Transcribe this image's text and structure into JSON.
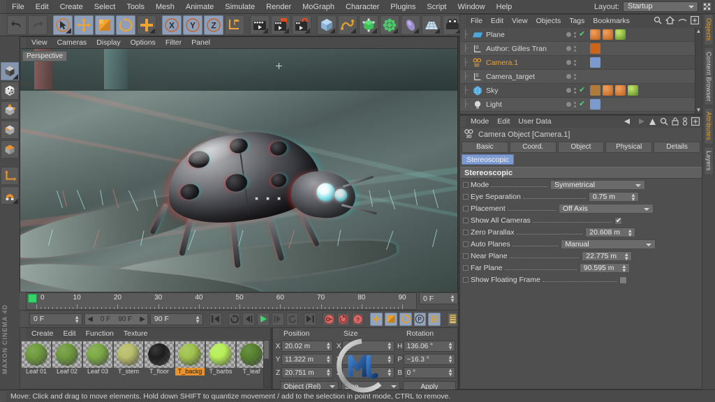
{
  "app": {
    "title": "CINEMA 4D",
    "brand": "MAXON CINEMA 4D"
  },
  "menubar": {
    "items": [
      "File",
      "Edit",
      "Create",
      "Select",
      "Tools",
      "Mesh",
      "Animate",
      "Simulate",
      "Render",
      "MoGraph",
      "Character",
      "Plugins",
      "Script",
      "Window",
      "Help"
    ],
    "layout_label": "Layout:",
    "layout_value": "Startup"
  },
  "toolbar": {
    "undo": "undo-icon",
    "redo": "redo-icon",
    "select": "live-selection-icon",
    "move": "move-icon",
    "scale": "scale-icon",
    "rotate": "rotate-icon",
    "add": "add-icon",
    "axis_x": "X",
    "axis_y": "Y",
    "axis_z": "Z",
    "world": "world-axis-icon",
    "render_view": "render-view-icon",
    "render_region": "render-region-icon",
    "render_settings": "render-settings-icon",
    "primitive": "cube-primitive-icon",
    "spline": "spline-icon",
    "generator": "generator-icon",
    "deformer": "deformer-icon",
    "scene_obj": "environment-icon",
    "scene_ground": "floor-icon",
    "camera": "camera-icon"
  },
  "lefttools": {
    "items": [
      "model-mode-icon",
      "texture-mode-icon",
      "points-mode-icon",
      "edges-mode-icon",
      "polygons-mode-icon",
      "axis-mode-icon",
      "magnet-icon"
    ]
  },
  "viewport": {
    "menu": [
      "View",
      "Cameras",
      "Display",
      "Options",
      "Filter",
      "Panel"
    ],
    "label": "Perspective",
    "scene_description": "Anaglyph stereoscopic render of a ladybug on a leaf"
  },
  "timeline": {
    "ticks": [
      0,
      10,
      20,
      30,
      40,
      50,
      60,
      70,
      80,
      90
    ],
    "current_frame": "0 F",
    "start_frame": "0 F",
    "preview_start": "0 F",
    "preview_end": "90 F",
    "end_frame": "90 F"
  },
  "transport": {
    "go_to_start": "go-to-start-icon",
    "loop": "loop-icon",
    "step_back": "step-back-icon",
    "play": "play-icon",
    "step_forward": "step-forward-icon",
    "replay": "replay-icon",
    "go_to_end": "go-to-end-icon",
    "record": "record-icon",
    "autokey": "autokey-icon",
    "keyframe_select": "keyframe-select-icon",
    "pos": "position-key-icon",
    "scale_k": "scale-key-icon",
    "rot": "rotation-key-icon",
    "param": "parameter-key-icon",
    "pla": "point-level-anim-icon",
    "timeline_btn": "timeline-icon"
  },
  "materials": {
    "menu": [
      "Create",
      "Edit",
      "Function",
      "Texture"
    ],
    "items": [
      {
        "name": "Leaf 01",
        "color": "#6d9a3a",
        "selected": false
      },
      {
        "name": "Leaf 02",
        "color": "#6d9a3a",
        "selected": false
      },
      {
        "name": "Leaf 03",
        "color": "#7aa842",
        "selected": false
      },
      {
        "name": "T_stem",
        "color": "#b8bd6a",
        "selected": false
      },
      {
        "name": "T_floor",
        "color": "#1c1c1c",
        "selected": false
      },
      {
        "name": "T_backg",
        "color": "#9fc14a",
        "selected": true
      },
      {
        "name": "T_barbs",
        "color": "#b6ee55",
        "selected": false
      },
      {
        "name": "T_leaf",
        "color": "#55802c",
        "selected": false
      }
    ]
  },
  "coordinates": {
    "headers": [
      "Position",
      "Size",
      "Rotation"
    ],
    "rows": [
      {
        "axis1": "X",
        "position": "20.02 m",
        "axis2": "X",
        "size": "",
        "axis3": "H",
        "rotation": "136.06 °"
      },
      {
        "axis1": "Y",
        "position": "11.322 m",
        "axis2": "Y",
        "size": "",
        "axis3": "P",
        "rotation": "−16.3 °"
      },
      {
        "axis1": "Z",
        "position": "20.751 m",
        "axis2": "Z",
        "size": "",
        "axis3": "B",
        "rotation": "0 °"
      }
    ],
    "mode_left": "Object (Rel)",
    "mode_right": "Size",
    "apply": "Apply"
  },
  "object_manager": {
    "menu": [
      "File",
      "Edit",
      "View",
      "Objects",
      "Tags",
      "Bookmarks"
    ],
    "icons": [
      "search-icon",
      "home-icon",
      "eye-icon",
      "expand-icon"
    ],
    "items": [
      {
        "name": "Plane",
        "icon": "plane-object-icon",
        "selected": false,
        "visible_check": true,
        "tags": [
          "material-tag",
          "material-tag",
          "texture-tag"
        ]
      },
      {
        "name": "Author: Gilles Tran",
        "icon": "null-object-icon",
        "selected": false,
        "visible_check": false,
        "tags": [
          "home-tag"
        ]
      },
      {
        "name": "Camera.1",
        "icon": "camera-object-icon",
        "selected": true,
        "visible_check": false,
        "tags": [
          "target-tag"
        ]
      },
      {
        "name": "Camera_target",
        "icon": "null-object-icon",
        "selected": false,
        "visible_check": false,
        "tags": []
      },
      {
        "name": "Sky",
        "icon": "sky-object-icon",
        "selected": false,
        "visible_check": true,
        "tags": [
          "render-tag",
          "material-tag",
          "material-tag",
          "texture-tag"
        ]
      },
      {
        "name": "Light",
        "icon": "light-object-icon",
        "selected": false,
        "visible_check": true,
        "tags": [
          "target-tag"
        ]
      }
    ]
  },
  "attribute_manager": {
    "menu": [
      "Mode",
      "Edit",
      "User Data"
    ],
    "icons": [
      "back-arrow-icon",
      "forward-arrow-icon",
      "up-arrow-icon",
      "search-icon",
      "lock-icon",
      "pin-icon",
      "expand-icon"
    ],
    "object_title": "Camera Object [Camera.1]",
    "tabs": [
      "Basic",
      "Coord.",
      "Object",
      "Physical",
      "Details"
    ],
    "tabs_row2": [
      "Stereoscopic"
    ],
    "active_tab": "Stereoscopic",
    "section_title": "Stereoscopic",
    "properties": [
      {
        "label": "Mode",
        "type": "dropdown",
        "value": "Symmetrical"
      },
      {
        "label": "Eye Separation",
        "type": "number",
        "value": "0.75 m"
      },
      {
        "label": "Placement",
        "type": "dropdown",
        "value": "Off Axis"
      },
      {
        "label": "Show All Cameras",
        "type": "checkbox",
        "value": true
      },
      {
        "label": "Zero Parallax",
        "type": "number",
        "value": "20.608 m"
      },
      {
        "label": "Auto Planes",
        "type": "dropdown",
        "value": "Manual"
      },
      {
        "label": "Near Plane",
        "type": "number",
        "value": "22.775 m"
      },
      {
        "label": "Far Plane",
        "type": "number",
        "value": "90.595 m"
      },
      {
        "label": "Show Floating Frame",
        "type": "checkbox",
        "value": false
      }
    ]
  },
  "right_tabs": [
    {
      "label": "Objects",
      "accent": true
    },
    {
      "label": "Content Browser",
      "accent": false
    },
    {
      "label": "Attributes",
      "accent": true
    },
    {
      "label": "Layers",
      "accent": false
    }
  ],
  "statusbar": {
    "text": "Move: Click and drag to move elements. Hold down SHIFT to quantize movement / add to the selection in point mode, CTRL to remove."
  },
  "colors": {
    "accent_orange": "#e8a33c",
    "selection_blue": "#7e9ad2",
    "playhead_green": "#36d36b",
    "panel_bg": "#4f4f4f",
    "menu_bg": "#4a4a4a"
  }
}
